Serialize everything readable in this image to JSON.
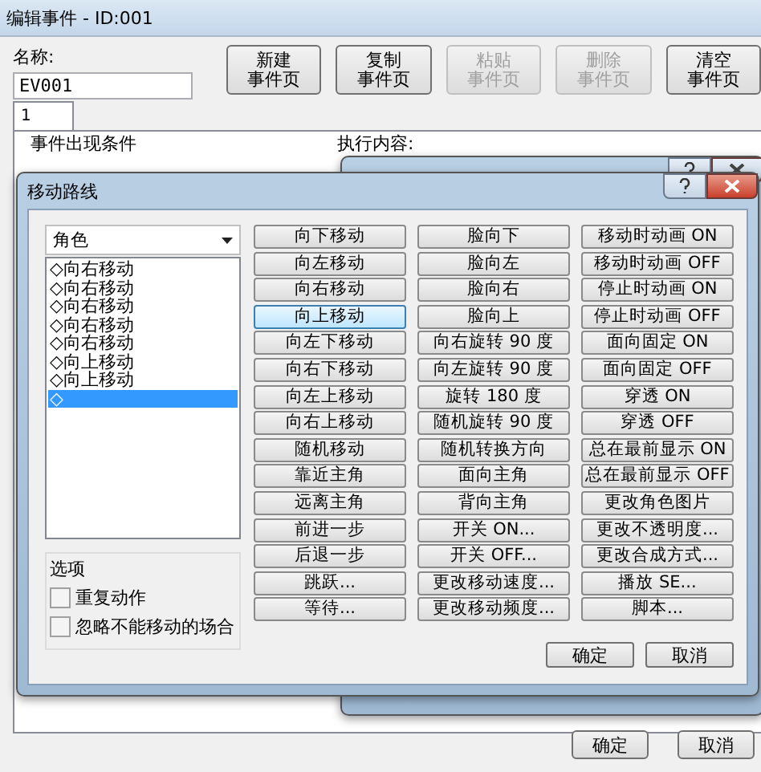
{
  "window": {
    "title": "编辑事件 - ID:001"
  },
  "name_field": {
    "label": "名称:",
    "value": "EV001"
  },
  "page_buttons": [
    {
      "label_lines": [
        "新建",
        "事件页"
      ],
      "disabled": false
    },
    {
      "label_lines": [
        "复制",
        "事件页"
      ],
      "disabled": false
    },
    {
      "label_lines": [
        "粘贴",
        "事件页"
      ],
      "disabled": true
    },
    {
      "label_lines": [
        "删除",
        "事件页"
      ],
      "disabled": true
    },
    {
      "label_lines": [
        "清空",
        "事件页"
      ],
      "disabled": false
    }
  ],
  "tabs": [
    {
      "label": "1",
      "selected": true
    }
  ],
  "conditions_group": {
    "title": "事件出现条件"
  },
  "contents_label": "执行内容:",
  "move_route_dialog": {
    "title": "移动路线",
    "target_dropdown": {
      "value": "角色"
    },
    "route_items": [
      {
        "label": "◇向右移动",
        "selected": false
      },
      {
        "label": "◇向右移动",
        "selected": false
      },
      {
        "label": "◇向右移动",
        "selected": false
      },
      {
        "label": "◇向右移动",
        "selected": false
      },
      {
        "label": "◇向右移动",
        "selected": false
      },
      {
        "label": "◇向上移动",
        "selected": false
      },
      {
        "label": "◇向上移动",
        "selected": false
      },
      {
        "label": "◇",
        "selected": true
      }
    ],
    "options": {
      "title": "选项",
      "items": [
        {
          "label": "重复动作",
          "checked": false
        },
        {
          "label": "忽略不能移动的场合",
          "checked": false
        }
      ]
    },
    "command_columns": [
      [
        {
          "label": "向下移动",
          "focused": false
        },
        {
          "label": "向左移动",
          "focused": false
        },
        {
          "label": "向右移动",
          "focused": false
        },
        {
          "label": "向上移动",
          "focused": true
        },
        {
          "label": "向左下移动",
          "focused": false
        },
        {
          "label": "向右下移动",
          "focused": false
        },
        {
          "label": "向左上移动",
          "focused": false
        },
        {
          "label": "向右上移动",
          "focused": false
        },
        {
          "label": "随机移动",
          "focused": false
        },
        {
          "label": "靠近主角",
          "focused": false
        },
        {
          "label": "远离主角",
          "focused": false
        },
        {
          "label": "前进一步",
          "focused": false
        },
        {
          "label": "后退一步",
          "focused": false
        },
        {
          "label": "跳跃...",
          "focused": false
        },
        {
          "label": "等待...",
          "focused": false
        }
      ],
      [
        {
          "label": "脸向下",
          "focused": false
        },
        {
          "label": "脸向左",
          "focused": false
        },
        {
          "label": "脸向右",
          "focused": false
        },
        {
          "label": "脸向上",
          "focused": false
        },
        {
          "label": "向右旋转 90 度",
          "focused": false
        },
        {
          "label": "向左旋转 90 度",
          "focused": false
        },
        {
          "label": "旋转 180 度",
          "focused": false
        },
        {
          "label": "随机旋转 90 度",
          "focused": false
        },
        {
          "label": "随机转换方向",
          "focused": false
        },
        {
          "label": "面向主角",
          "focused": false
        },
        {
          "label": "背向主角",
          "focused": false
        },
        {
          "label": "开关 ON...",
          "focused": false
        },
        {
          "label": "开关 OFF...",
          "focused": false
        },
        {
          "label": "更改移动速度...",
          "focused": false
        },
        {
          "label": "更改移动频度...",
          "focused": false
        }
      ],
      [
        {
          "label": "移动时动画 ON",
          "focused": false
        },
        {
          "label": "移动时动画 OFF",
          "focused": false
        },
        {
          "label": "停止时动画 ON",
          "focused": false
        },
        {
          "label": "停止时动画 OFF",
          "focused": false
        },
        {
          "label": "面向固定 ON",
          "focused": false
        },
        {
          "label": "面向固定 OFF",
          "focused": false
        },
        {
          "label": "穿透 ON",
          "focused": false
        },
        {
          "label": "穿透 OFF",
          "focused": false
        },
        {
          "label": "总在最前显示 ON",
          "focused": false
        },
        {
          "label": "总在最前显示 OFF",
          "focused": false
        },
        {
          "label": "更改角色图片",
          "focused": false
        },
        {
          "label": "更改不透明度...",
          "focused": false
        },
        {
          "label": "更改合成方式...",
          "focused": false
        },
        {
          "label": "播放 SE...",
          "focused": false
        },
        {
          "label": "脚本...",
          "focused": false
        }
      ]
    ],
    "buttons": [
      "确定",
      "取消"
    ]
  },
  "footer_buttons": [
    "确定",
    "取消"
  ]
}
